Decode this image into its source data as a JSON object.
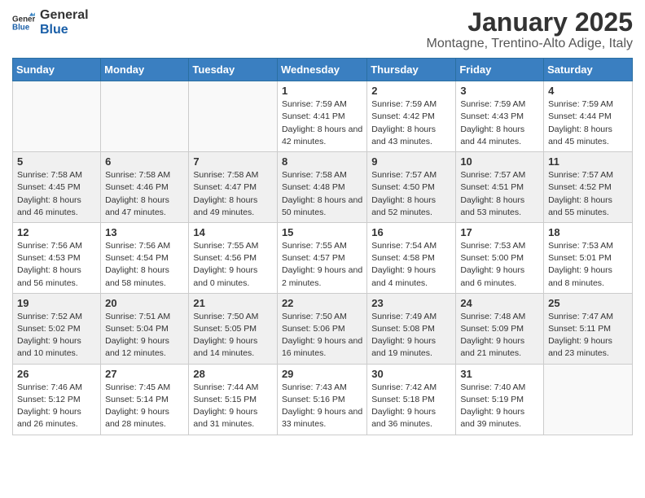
{
  "header": {
    "logo_line1": "General",
    "logo_line2": "Blue",
    "title": "January 2025",
    "subtitle": "Montagne, Trentino-Alto Adige, Italy"
  },
  "days_of_week": [
    "Sunday",
    "Monday",
    "Tuesday",
    "Wednesday",
    "Thursday",
    "Friday",
    "Saturday"
  ],
  "weeks": [
    [
      {
        "day": "",
        "info": ""
      },
      {
        "day": "",
        "info": ""
      },
      {
        "day": "",
        "info": ""
      },
      {
        "day": "1",
        "info": "Sunrise: 7:59 AM\nSunset: 4:41 PM\nDaylight: 8 hours and 42 minutes."
      },
      {
        "day": "2",
        "info": "Sunrise: 7:59 AM\nSunset: 4:42 PM\nDaylight: 8 hours and 43 minutes."
      },
      {
        "day": "3",
        "info": "Sunrise: 7:59 AM\nSunset: 4:43 PM\nDaylight: 8 hours and 44 minutes."
      },
      {
        "day": "4",
        "info": "Sunrise: 7:59 AM\nSunset: 4:44 PM\nDaylight: 8 hours and 45 minutes."
      }
    ],
    [
      {
        "day": "5",
        "info": "Sunrise: 7:58 AM\nSunset: 4:45 PM\nDaylight: 8 hours and 46 minutes."
      },
      {
        "day": "6",
        "info": "Sunrise: 7:58 AM\nSunset: 4:46 PM\nDaylight: 8 hours and 47 minutes."
      },
      {
        "day": "7",
        "info": "Sunrise: 7:58 AM\nSunset: 4:47 PM\nDaylight: 8 hours and 49 minutes."
      },
      {
        "day": "8",
        "info": "Sunrise: 7:58 AM\nSunset: 4:48 PM\nDaylight: 8 hours and 50 minutes."
      },
      {
        "day": "9",
        "info": "Sunrise: 7:57 AM\nSunset: 4:50 PM\nDaylight: 8 hours and 52 minutes."
      },
      {
        "day": "10",
        "info": "Sunrise: 7:57 AM\nSunset: 4:51 PM\nDaylight: 8 hours and 53 minutes."
      },
      {
        "day": "11",
        "info": "Sunrise: 7:57 AM\nSunset: 4:52 PM\nDaylight: 8 hours and 55 minutes."
      }
    ],
    [
      {
        "day": "12",
        "info": "Sunrise: 7:56 AM\nSunset: 4:53 PM\nDaylight: 8 hours and 56 minutes."
      },
      {
        "day": "13",
        "info": "Sunrise: 7:56 AM\nSunset: 4:54 PM\nDaylight: 8 hours and 58 minutes."
      },
      {
        "day": "14",
        "info": "Sunrise: 7:55 AM\nSunset: 4:56 PM\nDaylight: 9 hours and 0 minutes."
      },
      {
        "day": "15",
        "info": "Sunrise: 7:55 AM\nSunset: 4:57 PM\nDaylight: 9 hours and 2 minutes."
      },
      {
        "day": "16",
        "info": "Sunrise: 7:54 AM\nSunset: 4:58 PM\nDaylight: 9 hours and 4 minutes."
      },
      {
        "day": "17",
        "info": "Sunrise: 7:53 AM\nSunset: 5:00 PM\nDaylight: 9 hours and 6 minutes."
      },
      {
        "day": "18",
        "info": "Sunrise: 7:53 AM\nSunset: 5:01 PM\nDaylight: 9 hours and 8 minutes."
      }
    ],
    [
      {
        "day": "19",
        "info": "Sunrise: 7:52 AM\nSunset: 5:02 PM\nDaylight: 9 hours and 10 minutes."
      },
      {
        "day": "20",
        "info": "Sunrise: 7:51 AM\nSunset: 5:04 PM\nDaylight: 9 hours and 12 minutes."
      },
      {
        "day": "21",
        "info": "Sunrise: 7:50 AM\nSunset: 5:05 PM\nDaylight: 9 hours and 14 minutes."
      },
      {
        "day": "22",
        "info": "Sunrise: 7:50 AM\nSunset: 5:06 PM\nDaylight: 9 hours and 16 minutes."
      },
      {
        "day": "23",
        "info": "Sunrise: 7:49 AM\nSunset: 5:08 PM\nDaylight: 9 hours and 19 minutes."
      },
      {
        "day": "24",
        "info": "Sunrise: 7:48 AM\nSunset: 5:09 PM\nDaylight: 9 hours and 21 minutes."
      },
      {
        "day": "25",
        "info": "Sunrise: 7:47 AM\nSunset: 5:11 PM\nDaylight: 9 hours and 23 minutes."
      }
    ],
    [
      {
        "day": "26",
        "info": "Sunrise: 7:46 AM\nSunset: 5:12 PM\nDaylight: 9 hours and 26 minutes."
      },
      {
        "day": "27",
        "info": "Sunrise: 7:45 AM\nSunset: 5:14 PM\nDaylight: 9 hours and 28 minutes."
      },
      {
        "day": "28",
        "info": "Sunrise: 7:44 AM\nSunset: 5:15 PM\nDaylight: 9 hours and 31 minutes."
      },
      {
        "day": "29",
        "info": "Sunrise: 7:43 AM\nSunset: 5:16 PM\nDaylight: 9 hours and 33 minutes."
      },
      {
        "day": "30",
        "info": "Sunrise: 7:42 AM\nSunset: 5:18 PM\nDaylight: 9 hours and 36 minutes."
      },
      {
        "day": "31",
        "info": "Sunrise: 7:40 AM\nSunset: 5:19 PM\nDaylight: 9 hours and 39 minutes."
      },
      {
        "day": "",
        "info": ""
      }
    ]
  ]
}
